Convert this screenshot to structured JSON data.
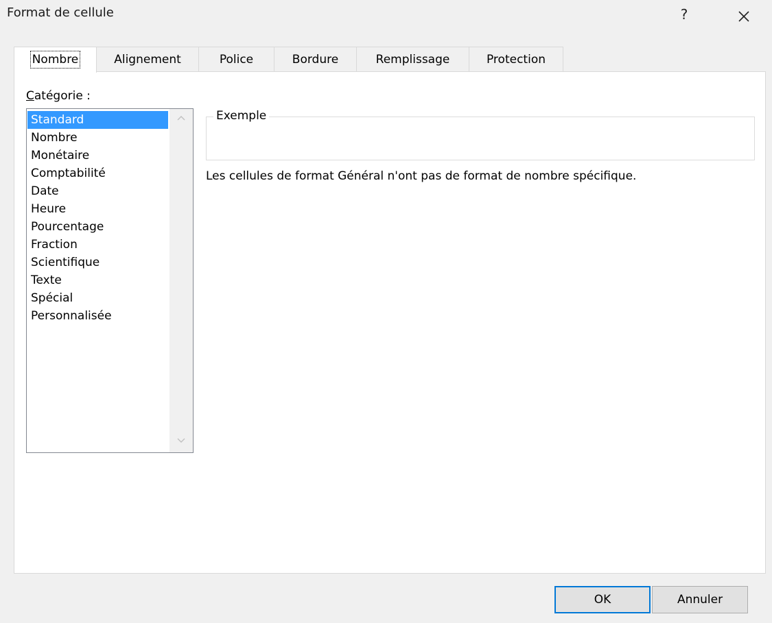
{
  "window": {
    "title": "Format de cellule",
    "help_label": "?"
  },
  "tabs": [
    {
      "label": "Nombre",
      "active": true
    },
    {
      "label": "Alignement",
      "active": false
    },
    {
      "label": "Police",
      "active": false
    },
    {
      "label": "Bordure",
      "active": false
    },
    {
      "label": "Remplissage",
      "active": false
    },
    {
      "label": "Protection",
      "active": false
    }
  ],
  "category": {
    "label_first": "C",
    "label_rest": "atégorie :",
    "items": [
      "Standard",
      "Nombre",
      "Monétaire",
      "Comptabilité",
      "Date",
      "Heure",
      "Pourcentage",
      "Fraction",
      "Scientifique",
      "Texte",
      "Spécial",
      "Personnalisée"
    ],
    "selected": "Standard"
  },
  "example": {
    "legend": "Exemple",
    "value": ""
  },
  "description": "Les cellules de format Général n'ont pas de format de nombre spécifique.",
  "buttons": {
    "ok": "OK",
    "cancel": "Annuler"
  },
  "colors": {
    "selection": "#3399ff",
    "default_button_border": "#0078d7"
  },
  "icons": {
    "close": "close-icon",
    "scroll_up": "chevron-up-icon",
    "scroll_down": "chevron-down-icon"
  }
}
